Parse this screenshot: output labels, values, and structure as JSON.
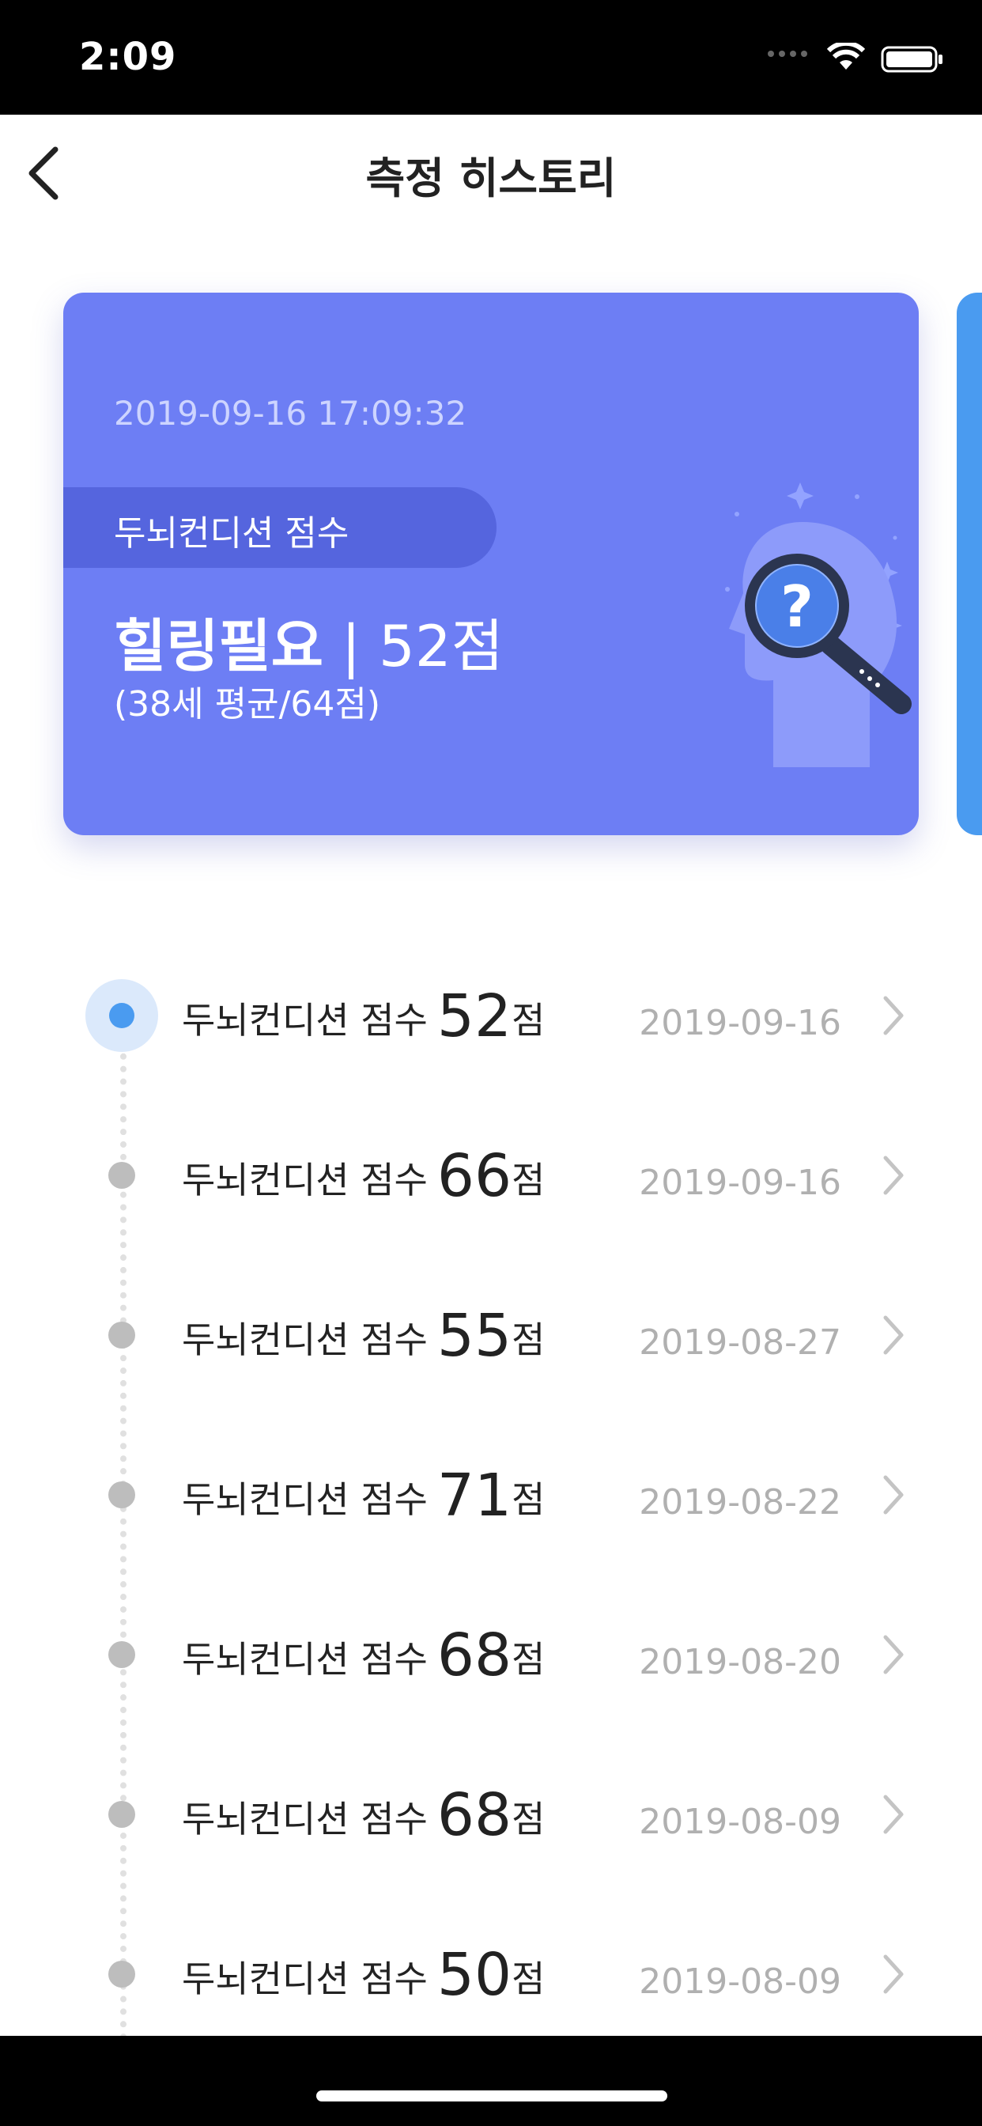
{
  "status_bar": {
    "time": "2:09"
  },
  "nav": {
    "title": "측정 히스토리"
  },
  "card": {
    "timestamp": "2019-09-16 17:09:32",
    "tag": "두뇌컨디션 점수",
    "status": "힐링필요",
    "separator": "|",
    "score": "52점",
    "average": "(38세 평균/64점)",
    "color": "#6d7ef4"
  },
  "list": {
    "items": [
      {
        "label": "두뇌컨디션 점수",
        "score": "52",
        "unit": "점",
        "date": "2019-09-16",
        "active": true
      },
      {
        "label": "두뇌컨디션 점수",
        "score": "66",
        "unit": "점",
        "date": "2019-09-16"
      },
      {
        "label": "두뇌컨디션 점수",
        "score": "55",
        "unit": "점",
        "date": "2019-08-27"
      },
      {
        "label": "두뇌컨디션 점수",
        "score": "71",
        "unit": "점",
        "date": "2019-08-22"
      },
      {
        "label": "두뇌컨디션 점수",
        "score": "68",
        "unit": "점",
        "date": "2019-08-20"
      },
      {
        "label": "두뇌컨디션 점수",
        "score": "68",
        "unit": "점",
        "date": "2019-08-09"
      },
      {
        "label": "두뇌컨디션 점수",
        "score": "50",
        "unit": "점",
        "date": "2019-08-09"
      }
    ]
  },
  "icons": {
    "back": "chevron-left-icon",
    "row": "chevron-right-icon",
    "illustration": "head-magnifier-question-icon"
  },
  "colors": {
    "accent": "#4a9bf0",
    "inactive_dot": "#bdbdbd",
    "date": "#b0b0b0"
  }
}
